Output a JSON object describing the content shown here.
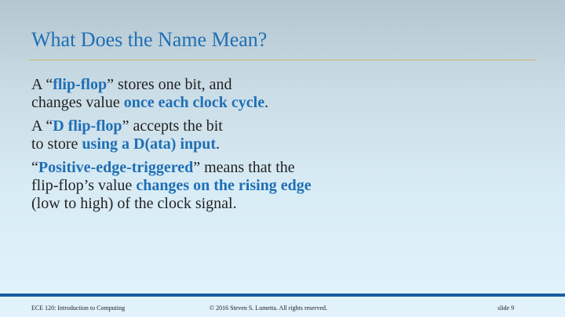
{
  "slide": {
    "title": "What Does the Name Mean?",
    "paragraphs": [
      {
        "line1": {
          "a": "A “",
          "b": "flip-flop",
          "c": "” stores one bit, and"
        },
        "line2": {
          "a": "changes value ",
          "b": "once each clock cycle",
          "c": "."
        }
      },
      {
        "line1": {
          "a": "A “",
          "b": "D flip-flop",
          "c": "” accepts the bit"
        },
        "line2": {
          "a": "to store ",
          "b": "using a D(ata) input",
          "c": "."
        }
      },
      {
        "line1": {
          "a": "“",
          "b": "Positive-edge-triggered",
          "c": "” means that the"
        },
        "line2": {
          "a": "flip-flop’s value ",
          "b": "changes on the rising edge",
          "c": ""
        },
        "line3": {
          "a": "(low to high) of the clock signal."
        }
      }
    ]
  },
  "footer": {
    "course": "ECE 120: Introduction to Computing",
    "copyright": "© 2016 Steven S. Lumetta.  All rights reserved.",
    "slide_number": "slide 9"
  },
  "colors": {
    "accent": "#1f6fb5",
    "title_rule": "#c9b56a",
    "footer_bar": "#1a5d9e"
  }
}
